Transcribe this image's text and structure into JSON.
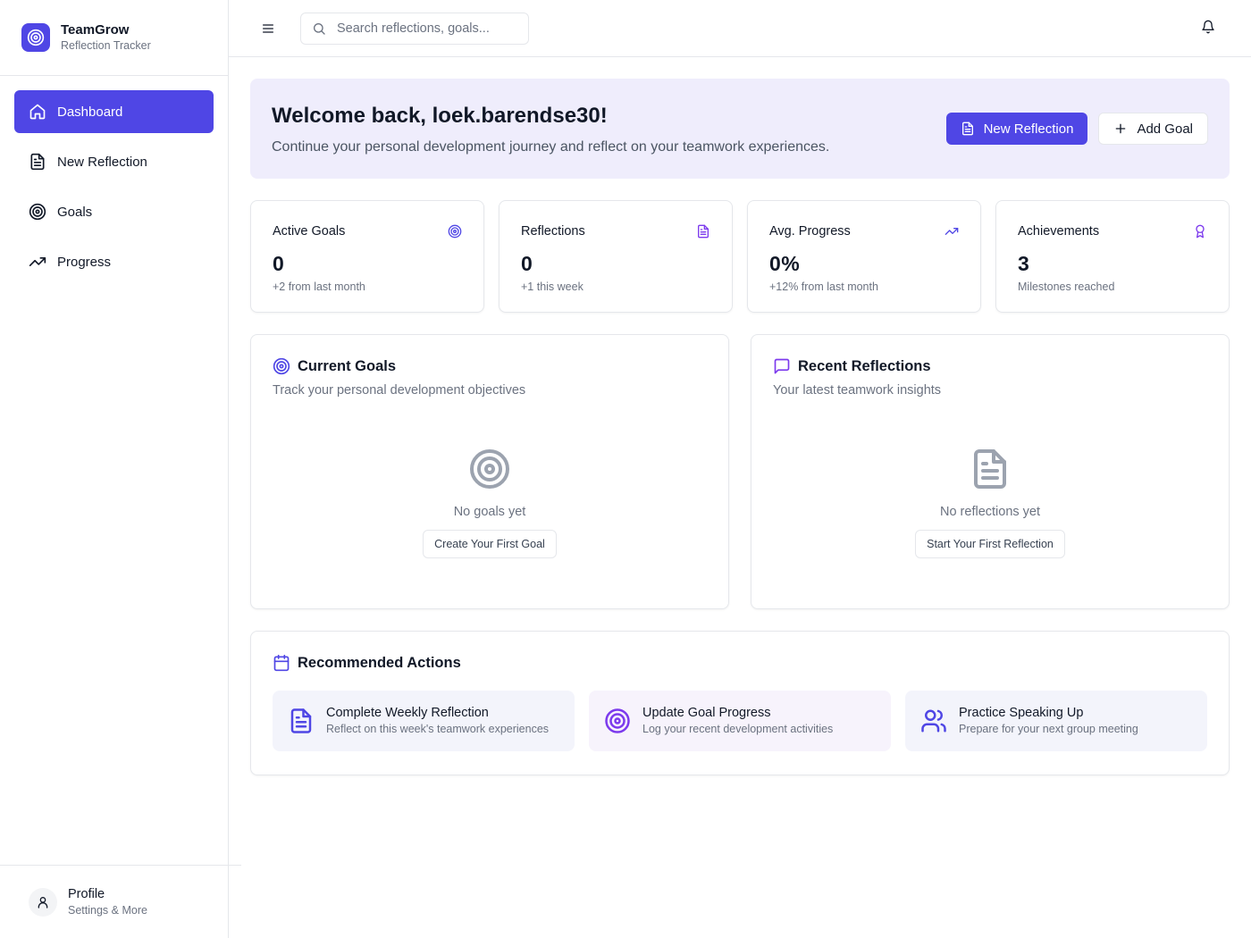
{
  "brand": {
    "title": "TeamGrow",
    "subtitle": "Reflection Tracker",
    "logo_icon": "target-icon",
    "color": "#4f46e5"
  },
  "sidebar": {
    "items": [
      {
        "label": "Dashboard",
        "icon": "home-icon",
        "active": true
      },
      {
        "label": "New Reflection",
        "icon": "document-icon",
        "active": false
      },
      {
        "label": "Goals",
        "icon": "target-icon",
        "active": false
      },
      {
        "label": "Progress",
        "icon": "trending-up-icon",
        "active": false
      }
    ],
    "profile": {
      "title": "Profile",
      "subtitle": "Settings & More",
      "icon": "user-icon"
    }
  },
  "header": {
    "search_placeholder": "Search reflections, goals...",
    "menu_icon": "menu-icon",
    "bell_icon": "bell-icon"
  },
  "welcome": {
    "title": "Welcome back, loek.barendse30!",
    "subtitle": "Continue your personal development journey and reflect on your teamwork experiences.",
    "new_reflection_label": "New Reflection",
    "add_goal_label": "Add Goal"
  },
  "stats": [
    {
      "title": "Active Goals",
      "value": "0",
      "sub": "+2 from last month",
      "icon": "target-icon"
    },
    {
      "title": "Reflections",
      "value": "0",
      "sub": "+1 this week",
      "icon": "document-icon"
    },
    {
      "title": "Avg. Progress",
      "value": "0%",
      "sub": "+12% from last month",
      "icon": "trending-up-icon"
    },
    {
      "title": "Achievements",
      "value": "3",
      "sub": "Milestones reached",
      "icon": "award-icon"
    }
  ],
  "goals_panel": {
    "title": "Current Goals",
    "subtitle": "Track your personal development objectives",
    "empty_text": "No goals yet",
    "button_label": "Create Your First Goal"
  },
  "reflections_panel": {
    "title": "Recent Reflections",
    "subtitle": "Your latest teamwork insights",
    "empty_text": "No reflections yet",
    "button_label": "Start Your First Reflection"
  },
  "recommended": {
    "title": "Recommended Actions",
    "items": [
      {
        "title": "Complete Weekly Reflection",
        "sub": "Reflect on this week's teamwork experiences",
        "icon": "document-icon"
      },
      {
        "title": "Update Goal Progress",
        "sub": "Log your recent development activities",
        "icon": "target-icon"
      },
      {
        "title": "Practice Speaking Up",
        "sub": "Prepare for your next group meeting",
        "icon": "users-icon"
      }
    ]
  },
  "colors": {
    "accent": "#4f46e5",
    "purple": "#7c3aed",
    "welcome_bg": "#efedfc"
  }
}
